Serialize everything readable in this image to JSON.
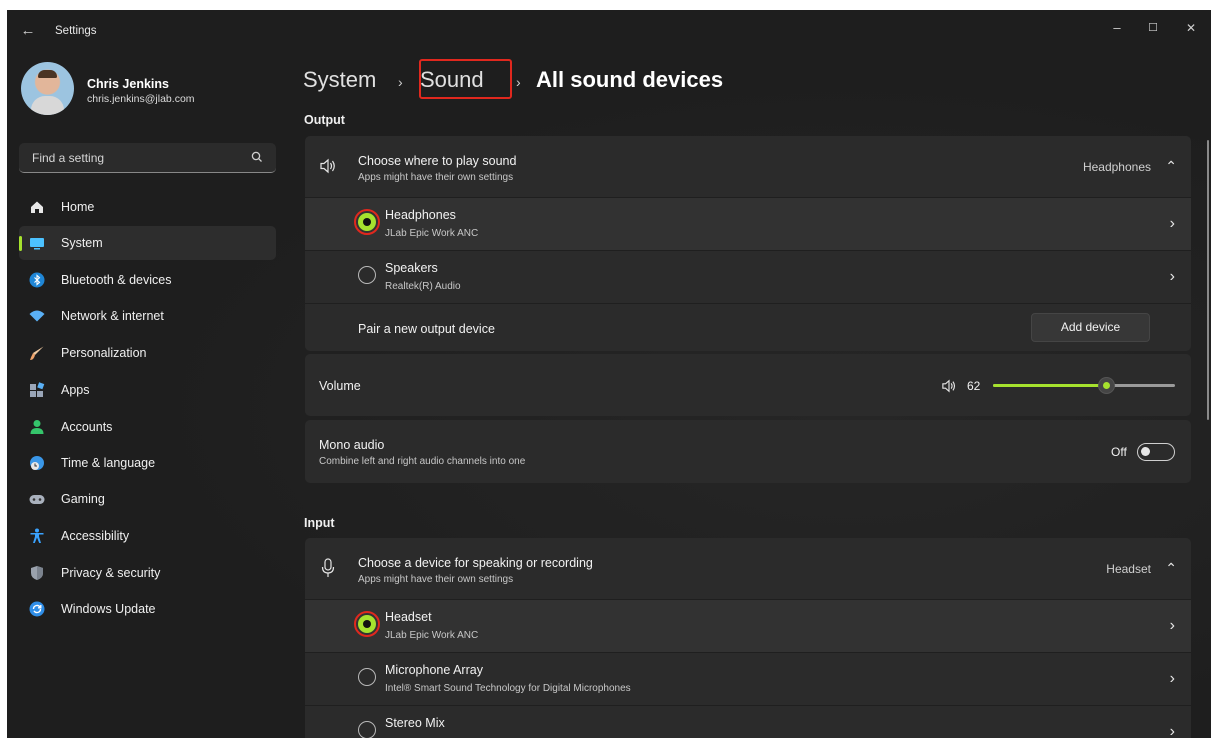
{
  "window": {
    "title": "Settings",
    "controls": {
      "minimize": "–",
      "maximize": "☐",
      "close": "✕"
    }
  },
  "profile": {
    "name": "Chris Jenkins",
    "email": "chris.jenkins@jlab.com"
  },
  "search": {
    "placeholder": "Find a setting"
  },
  "sidebar": {
    "selected": "System",
    "items": [
      {
        "label": "Home",
        "icon": "home-icon",
        "color": "#e8e8e8"
      },
      {
        "label": "System",
        "icon": "system-icon",
        "color": "#4cc2ff"
      },
      {
        "label": "Bluetooth & devices",
        "icon": "bluetooth-icon",
        "color": "#1f86d6"
      },
      {
        "label": "Network & internet",
        "icon": "wifi-icon",
        "color": "#5ab0f5"
      },
      {
        "label": "Personalization",
        "icon": "brush-icon",
        "color": "#f0a36a"
      },
      {
        "label": "Apps",
        "icon": "apps-icon",
        "color": "#9aa6b8"
      },
      {
        "label": "Accounts",
        "icon": "accounts-icon",
        "color": "#35c56b"
      },
      {
        "label": "Time & language",
        "icon": "globe-clock-icon",
        "color": "#3a97e8"
      },
      {
        "label": "Gaming",
        "icon": "gamepad-icon",
        "color": "#a9b1bd"
      },
      {
        "label": "Accessibility",
        "icon": "accessibility-icon",
        "color": "#3aa3ff"
      },
      {
        "label": "Privacy & security",
        "icon": "shield-icon",
        "color": "#9aa2ad"
      },
      {
        "label": "Windows Update",
        "icon": "update-icon",
        "color": "#2f8ee8"
      }
    ]
  },
  "breadcrumb": {
    "items": [
      "System",
      "Sound",
      "All sound devices"
    ],
    "separator": "›"
  },
  "output": {
    "section_label": "Output",
    "chooser": {
      "title": "Choose where to play sound",
      "subtitle": "Apps might have their own settings",
      "value": "Headphones"
    },
    "devices": [
      {
        "name": "Headphones",
        "detail": "JLab Epic Work ANC",
        "selected": true
      },
      {
        "name": "Speakers",
        "detail": "Realtek(R) Audio",
        "selected": false
      }
    ],
    "pair": {
      "label": "Pair a new output device",
      "button": "Add device"
    }
  },
  "volume": {
    "label": "Volume",
    "value": "62",
    "level": 0.62
  },
  "mono": {
    "title": "Mono audio",
    "subtitle": "Combine left and right audio channels into one",
    "state": "Off"
  },
  "input": {
    "section_label": "Input",
    "chooser": {
      "title": "Choose a device for speaking or recording",
      "subtitle": "Apps might have their own settings",
      "value": "Headset"
    },
    "devices": [
      {
        "name": "Headset",
        "detail": "JLab Epic Work ANC",
        "selected": true
      },
      {
        "name": "Microphone Array",
        "detail": "Intel® Smart Sound Technology for Digital Microphones",
        "selected": false
      },
      {
        "name": "Stereo Mix",
        "detail": "",
        "selected": false
      }
    ]
  },
  "colors": {
    "accent": "#a6e22e",
    "highlight": "#e0281e",
    "background": "#1f1f1f",
    "card": "#2b2b2b"
  }
}
